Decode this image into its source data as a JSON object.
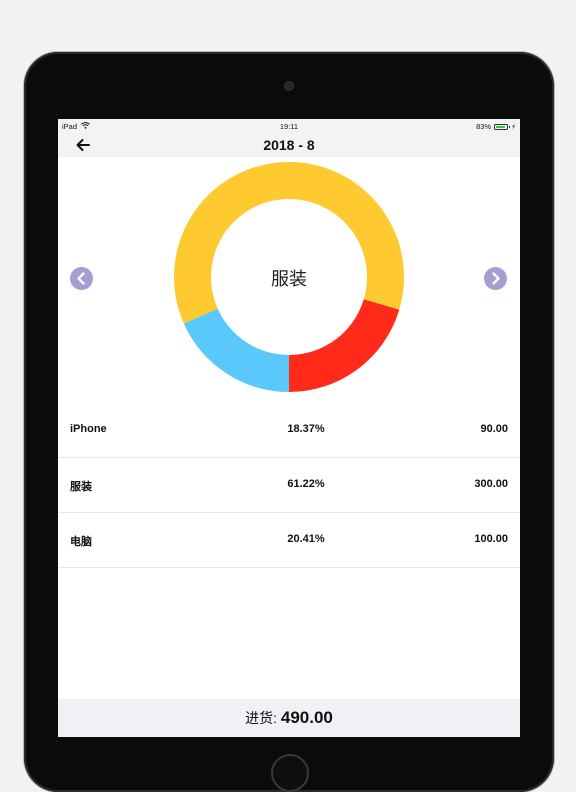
{
  "status_bar": {
    "device": "iPad",
    "time": "19:11",
    "battery": "83%"
  },
  "nav": {
    "title": "2018 - 8",
    "back_icon": "arrow-left-icon"
  },
  "chart_data": {
    "type": "pie",
    "title": "",
    "center_label": "服装",
    "categories": [
      "iPhone",
      "服装",
      "电脑"
    ],
    "values": [
      90.0,
      300.0,
      100.0
    ],
    "percent": [
      18.37,
      61.22,
      20.41
    ],
    "colors": {
      "iPhone": "#5ac8fa",
      "服装": "#ffc930",
      "电脑": "#ff2a1a"
    }
  },
  "nav_arrows": {
    "prev_icon": "chevron-left-icon",
    "next_icon": "chevron-right-icon",
    "color": "#a39fd3"
  },
  "rows": [
    {
      "name": "iPhone",
      "percent": "18.37%",
      "amount": "90.00"
    },
    {
      "name": "服装",
      "percent": "61.22%",
      "amount": "300.00"
    },
    {
      "name": "电脑",
      "percent": "20.41%",
      "amount": "100.00"
    }
  ],
  "footer": {
    "label": "进货: ",
    "total": "490.00"
  }
}
